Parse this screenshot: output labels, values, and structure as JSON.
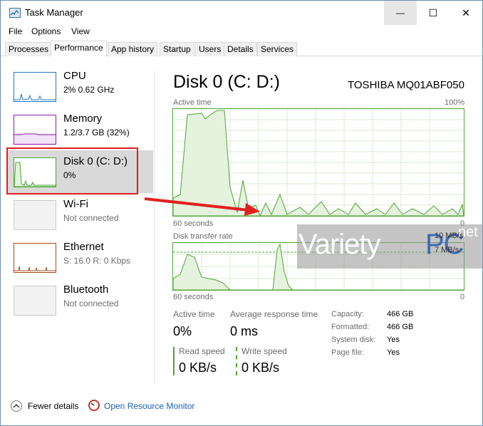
{
  "window": {
    "title": "Task Manager",
    "controls": {
      "minimize": "—",
      "maximize": "☐",
      "close": "✕"
    }
  },
  "menu": [
    "File",
    "Options",
    "View"
  ],
  "tabs": [
    "Processes",
    "Performance",
    "App history",
    "Startup",
    "Users",
    "Details",
    "Services"
  ],
  "active_tab": "Performance",
  "sidebar": {
    "items": [
      {
        "name": "CPU",
        "sub": "2% 0.62 GHz",
        "color": "#1a79c5"
      },
      {
        "name": "Memory",
        "sub": "1.2/3.7 GB (32%)",
        "color": "#8b1aa8"
      },
      {
        "name": "Disk 0 (C: D:)",
        "sub": "0%",
        "color": "#4da633"
      },
      {
        "name": "Wi-Fi",
        "sub": "Not connected",
        "color": "#cccccc"
      },
      {
        "name": "Ethernet",
        "sub": "S: 16.0  R: 0 Kbps",
        "color": "#a84b10"
      },
      {
        "name": "Bluetooth",
        "sub": "Not connected",
        "color": "#cccccc"
      }
    ]
  },
  "main": {
    "title": "Disk 0 (C: D:)",
    "model": "TOSHIBA MQ01ABF050",
    "active_graph": {
      "label": "Active time",
      "max_label": "100%",
      "x_label": "60 seconds",
      "min_label": "0"
    },
    "transfer_graph": {
      "label": "Disk transfer rate",
      "max_label": "10 MB/s",
      "mid_label": "7 MB/s",
      "x_label": "60 seconds",
      "min_label": "0"
    },
    "stats": {
      "active_time_label": "Active time",
      "active_time_value": "0%",
      "avg_response_label": "Average response time",
      "avg_response_value": "0 ms",
      "read_label": "Read speed",
      "read_value": "0 KB/s",
      "write_label": "Write speed",
      "write_value": "0 KB/s"
    },
    "details": [
      {
        "label": "Capacity:",
        "value": "466 GB"
      },
      {
        "label": "Formatted:",
        "value": "466 GB"
      },
      {
        "label": "System disk:",
        "value": "Yes"
      },
      {
        "label": "Page file:",
        "value": "Yes"
      }
    ]
  },
  "footer": {
    "fewer_details": "Fewer details",
    "open_resource_monitor": "Open Resource Monitor"
  },
  "watermark": {
    "brand_a": "Variety",
    "brand_b": "PC",
    "brand_c": "net"
  },
  "accent": {
    "disk_green": "#4da633",
    "highlight_red": "#e0201e",
    "link_blue": "#1a5fb4"
  }
}
